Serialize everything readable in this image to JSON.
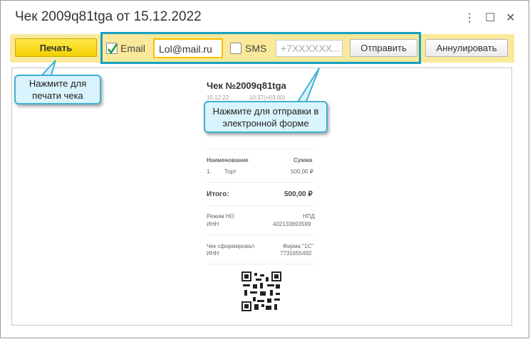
{
  "window": {
    "title": "Чек 2009q81tga от 15.12.2022",
    "menu_icon": "⋮",
    "maximize_icon": "☐",
    "close_icon": "✕"
  },
  "toolbar": {
    "print": "Печать",
    "email_label": "Email",
    "email_checked": true,
    "email_value": "Lol@mail.ru",
    "sms_label": "SMS",
    "sms_checked": false,
    "phone_placeholder": "+7XXXXXX...",
    "send": "Отправить",
    "cancel": "Аннулировать"
  },
  "receipt": {
    "title": "Чек №2009q81tga",
    "date": "15.12.22",
    "time": "10:37(+03:00)",
    "col_name": "Наименование",
    "col_sum": "Сумма",
    "item_no": "1.",
    "item_name": "Торт",
    "item_sum": "500,00 ₽",
    "total_label": "Итого:",
    "total_value": "500,00 ₽",
    "tax_label": "Режим НО",
    "tax_value": "НПД",
    "inn_label": "ИНН",
    "inn_value": "402133693599",
    "issuer_label": "Чек сформировал",
    "issuer_value": "Фирма \"1С\"",
    "inn2_label": "ИНН",
    "inn2_value": "7731655492"
  },
  "callouts": {
    "print": "Нажмите для печати чека",
    "send": "Нажмите для отправки в электронной форме"
  }
}
